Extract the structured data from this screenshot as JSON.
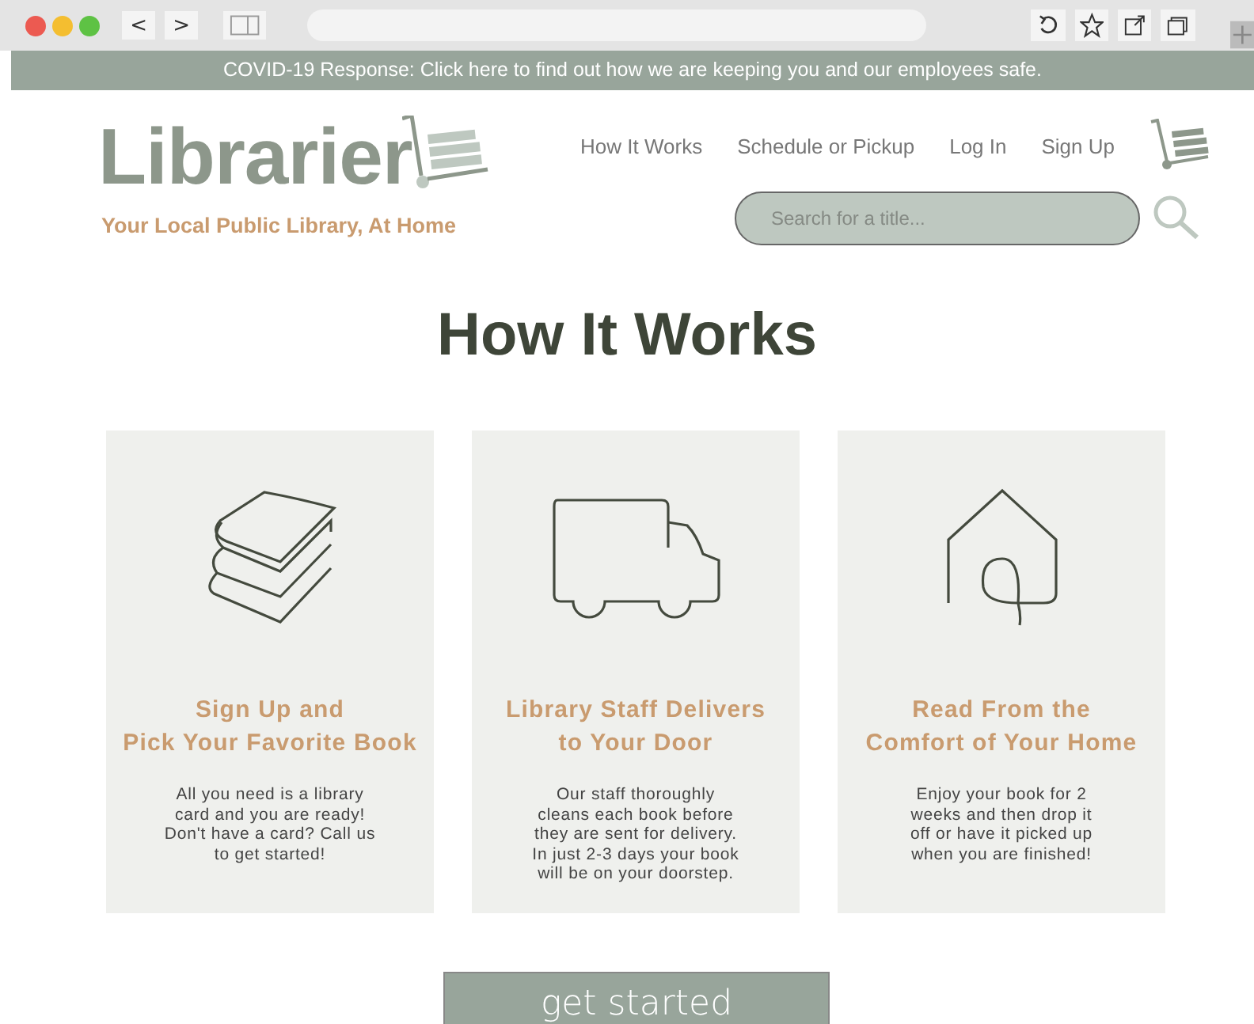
{
  "browser": {
    "nav_buttons": [
      "<",
      ">"
    ]
  },
  "banner": {
    "text": "COVID-19 Response: Click here to find out how we are keeping you and our employees safe."
  },
  "header": {
    "logo": "Librarier",
    "tagline": "Your Local Public Library, At Home",
    "nav": [
      "How It Works",
      "Schedule or Pickup",
      "Log In",
      "Sign Up"
    ],
    "search": {
      "placeholder": "Search for a title..."
    }
  },
  "heading": "How It Works",
  "steps": [
    {
      "kind": "books",
      "title": "Sign Up and\nPick Your Favorite Book",
      "body": "All you need is a library\ncard and you are ready!\nDon't have a card? Call us\nto get started!"
    },
    {
      "kind": "truck",
      "title": "Library Staff Delivers\nto Your Door",
      "body": "Our staff thoroughly\ncleans each book before\nthey are sent for delivery.\nIn just 2-3 days your book\nwill be on your doorstep."
    },
    {
      "kind": "house",
      "title": "Read From the\nComfort of Your Home",
      "body": "Enjoy your book for 2\nweeks and then drop it\noff or have it picked up\nwhen you are finished!"
    }
  ],
  "cta": "get started"
}
